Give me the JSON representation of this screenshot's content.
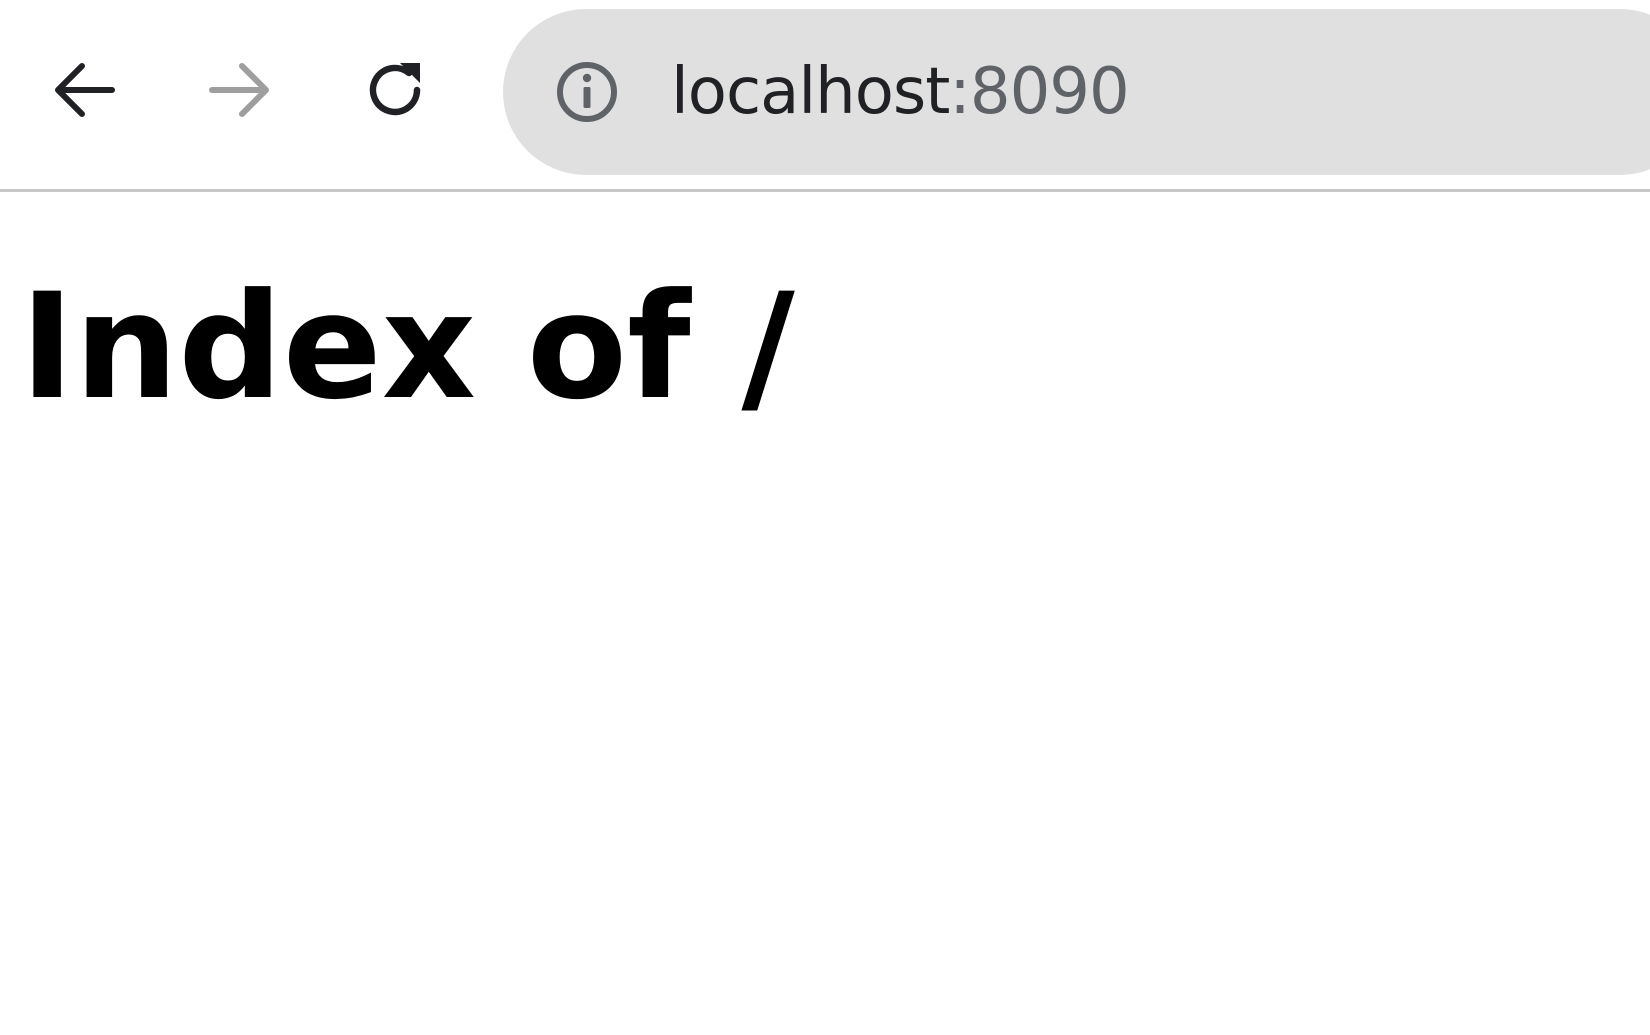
{
  "browser": {
    "back_icon": "arrow-left-icon",
    "forward_icon": "arrow-right-icon",
    "reload_icon": "reload-icon",
    "site_info_icon": "info-circle-icon",
    "address": {
      "host": "localhost",
      "port_suffix": ":8090"
    },
    "colors": {
      "omnibox_bg": "#e0e0e0",
      "icon_active": "#202124",
      "icon_disabled": "#9e9e9e"
    }
  },
  "page": {
    "heading": "Index of /"
  }
}
